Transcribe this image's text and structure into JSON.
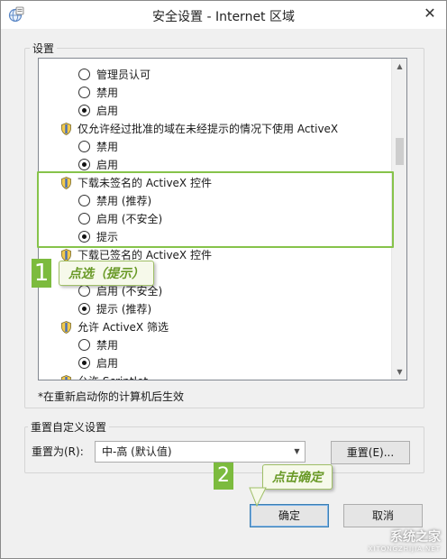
{
  "window": {
    "title": "安全设置 - Internet 区域",
    "close": "✕"
  },
  "settings": {
    "legend": "设置"
  },
  "list": [
    {
      "kind": "option",
      "label": "管理员认可",
      "checked": false
    },
    {
      "kind": "option",
      "label": "禁用",
      "checked": false
    },
    {
      "kind": "option",
      "label": "启用",
      "checked": true
    },
    {
      "kind": "header",
      "label": "仅允许经过批准的域在未经提示的情况下使用 ActiveX"
    },
    {
      "kind": "option",
      "label": "禁用",
      "checked": false
    },
    {
      "kind": "option",
      "label": "启用",
      "checked": true
    },
    {
      "kind": "header",
      "label": "下载未签名的 ActiveX 控件"
    },
    {
      "kind": "option",
      "label": "禁用 (推荐)",
      "checked": false
    },
    {
      "kind": "option",
      "label": "启用 (不安全)",
      "checked": false
    },
    {
      "kind": "option",
      "label": "提示",
      "checked": true
    },
    {
      "kind": "header",
      "label": "下载已签名的 ActiveX 控件"
    },
    {
      "kind": "option",
      "label": "禁用",
      "checked": false
    },
    {
      "kind": "option",
      "label": "启用 (不安全)",
      "checked": false
    },
    {
      "kind": "option",
      "label": "提示 (推荐)",
      "checked": true
    },
    {
      "kind": "header",
      "label": "允许 ActiveX 筛选"
    },
    {
      "kind": "option",
      "label": "禁用",
      "checked": false
    },
    {
      "kind": "option",
      "label": "启用",
      "checked": true
    },
    {
      "kind": "header",
      "label": "允许 Scriptlet"
    }
  ],
  "note": "*在重新启动你的计算机后生效",
  "reset_group": {
    "legend": "重置自定义设置",
    "label": "重置为(R):",
    "selected": "中-高 (默认值)",
    "reset_button": "重置(E)..."
  },
  "buttons": {
    "ok": "确定",
    "cancel": "取消"
  },
  "annotations": {
    "step1_number": "1",
    "step1_text": "点选（提示）",
    "step2_number": "2",
    "step2_text": "点击确定",
    "accent_color": "#86c34a"
  },
  "watermark": {
    "name": "系统之家",
    "url": "XITONGZHIJIA.NET"
  }
}
